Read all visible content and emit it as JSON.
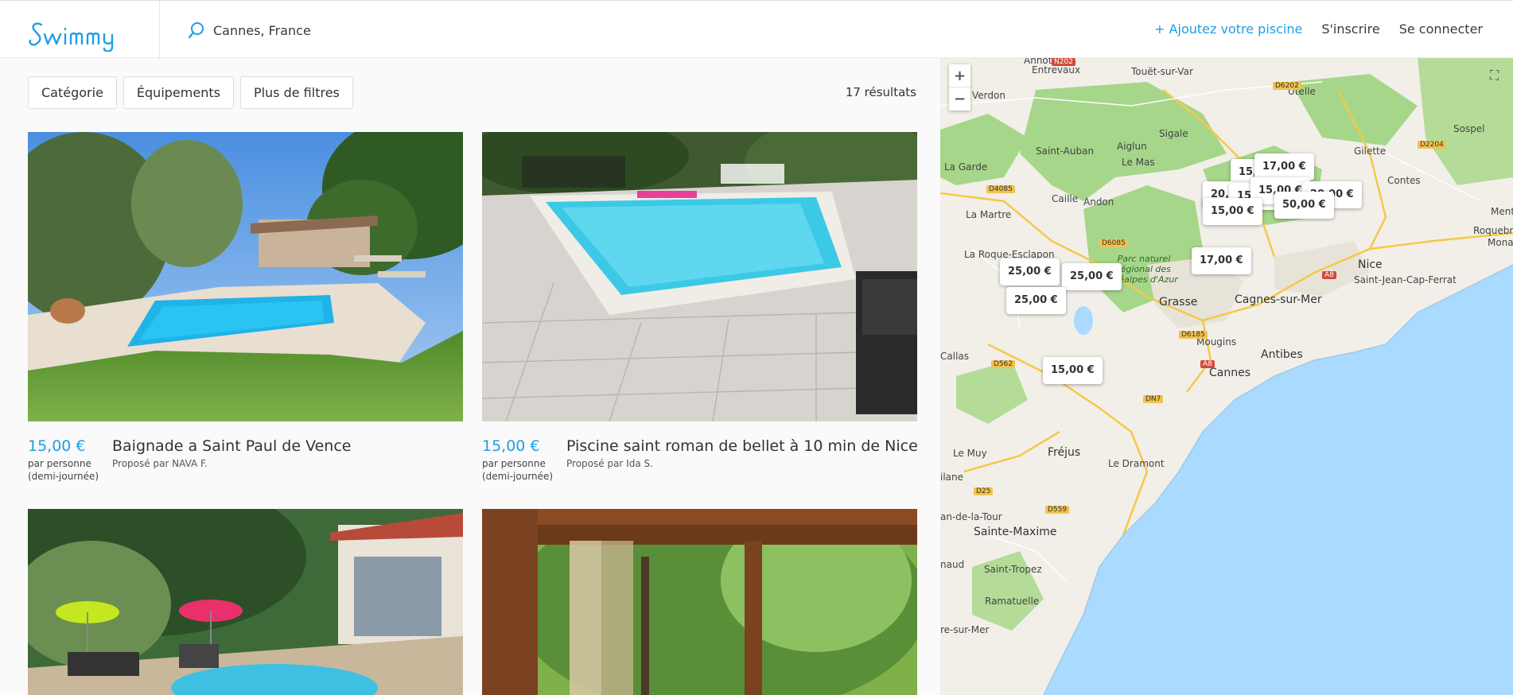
{
  "header": {
    "logo_text": "Swimmy",
    "search_value": "Cannes, France",
    "nav": {
      "add_pool": "+ Ajoutez votre piscine",
      "signup": "S'inscrire",
      "login": "Se connecter"
    }
  },
  "filters": {
    "category": "Catégorie",
    "equipment": "Équipements",
    "more": "Plus de filtres",
    "results": "17 résultats"
  },
  "listings": [
    {
      "price": "15,00 €",
      "price_unit": "par personne",
      "price_period": "(demi-journée)",
      "title": "Baignade a Saint Paul de Vence",
      "owner": "Proposé par NAVA F."
    },
    {
      "price": "15,00 €",
      "price_unit": "par personne",
      "price_period": "(demi-journée)",
      "title": "Piscine saint roman de bellet à 10 min de Nice",
      "owner": "Proposé par Ida S."
    }
  ],
  "map": {
    "zoom_in": "+",
    "zoom_out": "−",
    "pins": [
      "15,00 €",
      "17,00 €",
      "20,00 €",
      "15,00 €",
      "15,00 €",
      "20,00 €",
      "15,00 €",
      "50,00 €",
      "17,00 €",
      "25,00 €",
      "25,00 €",
      "25,00 €",
      "15,00 €"
    ],
    "places": [
      "Entrevaux",
      "Touët-sur-Var",
      "Utelle",
      "Sospel",
      "Verdon",
      "Sigale",
      "Aiglun",
      "Saint-Auban",
      "Le Mas",
      "Gilette",
      "La Garde",
      "Contes",
      "Caille",
      "Andon",
      "La Martre",
      "Menton",
      "Roquebrune-Cap",
      "Monaco",
      "La Roque-Esclapon",
      "Parc naturel régional des Préalpes d'Azur",
      "Nice",
      "Saint-Jean-Cap-Ferrat",
      "Grasse",
      "Cagnes-sur-Mer",
      "Mougins",
      "Antibes",
      "Callas",
      "Cannes",
      "Le Muy",
      "Fréjus",
      "Le Dramont",
      "Sainte-Maxime",
      "Saint-Tropez",
      "Ramatuelle",
      "Annot",
      "an-de-la-Tour",
      "naud",
      "re-sur-Mer",
      "ilane"
    ],
    "roads": [
      "N202",
      "D6202",
      "D2204",
      "D4085",
      "D6085",
      "A8",
      "D6185",
      "D562",
      "A8",
      "DN7",
      "D25",
      "D559"
    ]
  },
  "colors": {
    "brand": "#1e9fe3",
    "sea": "#aadaff",
    "land": "#f2efe9",
    "park": "#a6d68a"
  }
}
